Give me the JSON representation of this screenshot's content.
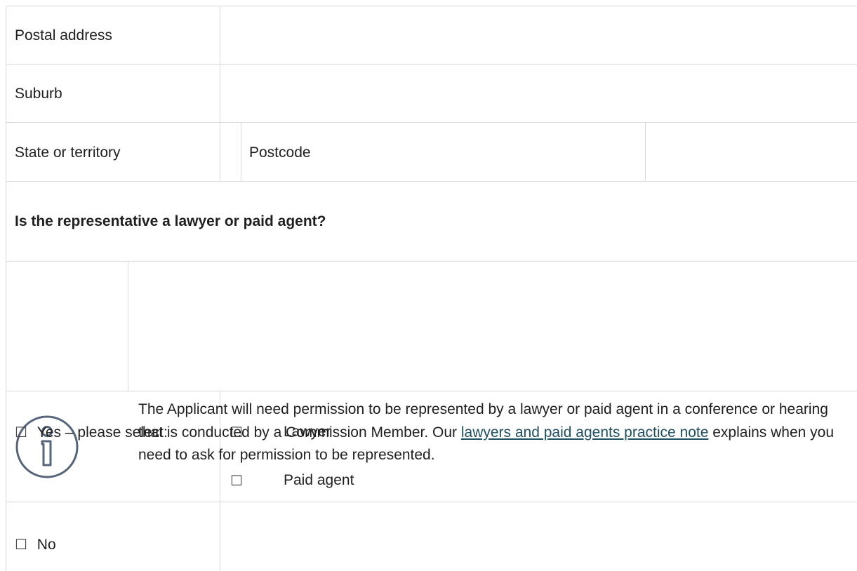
{
  "form": {
    "postal_address_label": "Postal address",
    "suburb_label": "Suburb",
    "state_label": "State or territory",
    "postcode_label": "Postcode",
    "question": "Is the representative a lawyer or paid agent?",
    "info": {
      "text_before": "The Applicant will need permission to be represented by a lawyer or paid agent in a conference or hearing that is conducted by a Commission Member. Our ",
      "link_text": "lawyers and paid agents practice note",
      "text_after": " explains when you need to ask for permission to be represented.",
      "icon": "info-icon"
    },
    "checkbox_glyph": "☐",
    "yes_label": "Yes – please select:",
    "lawyer_label": "Lawyer",
    "paid_agent_label": "Paid agent",
    "no_label": "No"
  }
}
